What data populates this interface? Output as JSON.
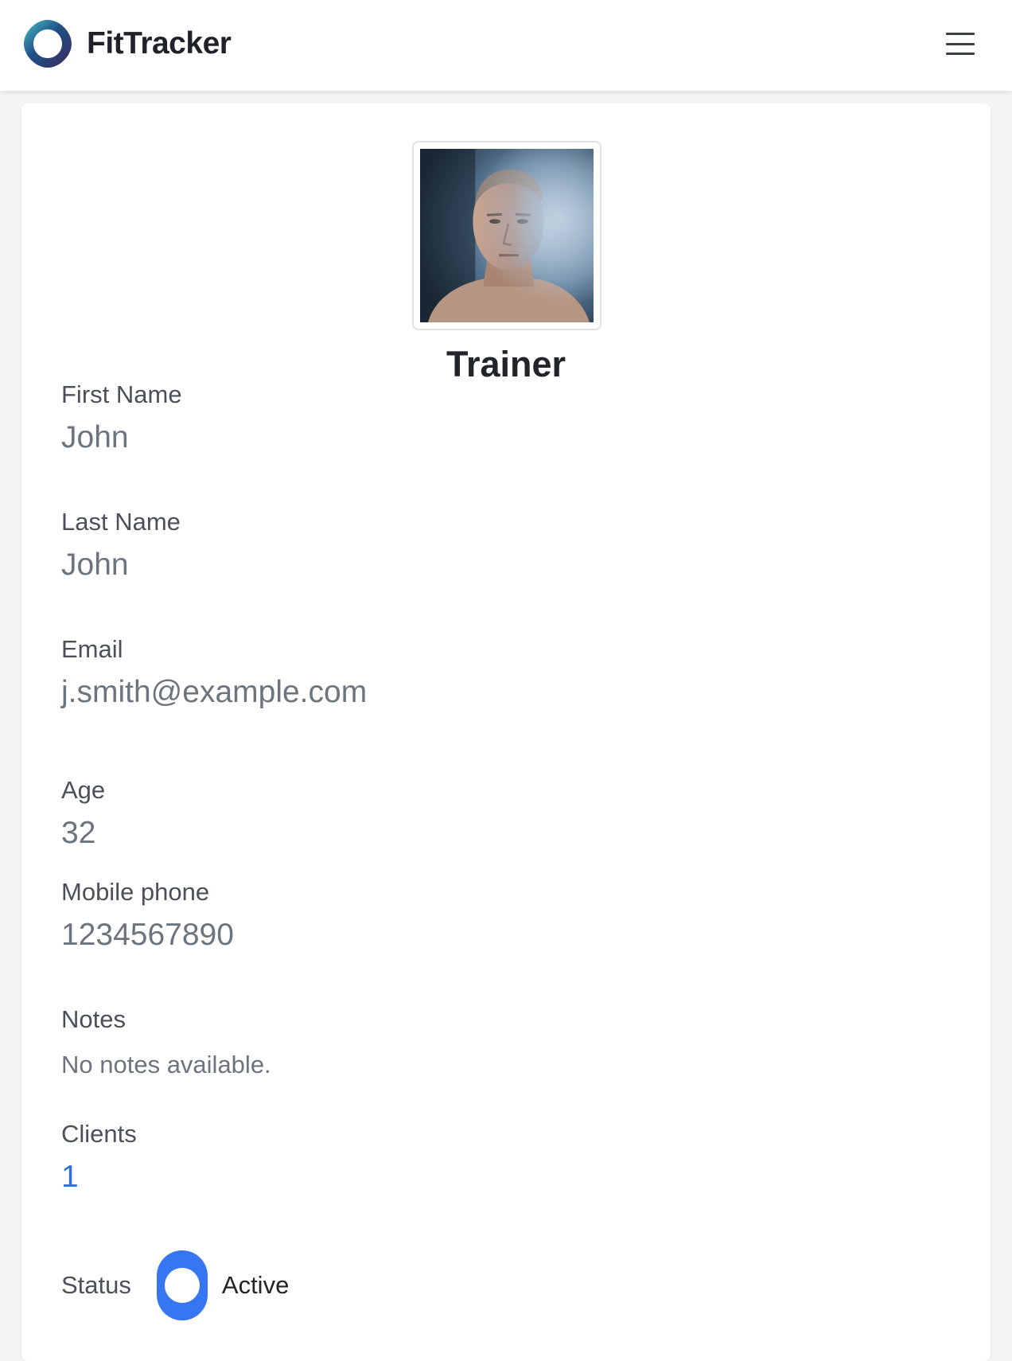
{
  "app": {
    "name": "FitTracker",
    "colors": {
      "accent": "#3676f2",
      "link": "#2f6fe4",
      "text_primary": "#212529",
      "text_muted": "#6c757d"
    }
  },
  "navbar": {
    "logo_icon": "ring-logo-icon",
    "menu_icon": "hamburger-menu-icon"
  },
  "profile": {
    "role": "Trainer",
    "fields": {
      "first_name": {
        "label": "First Name",
        "value": "John"
      },
      "last_name": {
        "label": "Last Name",
        "value": "John"
      },
      "email": {
        "label": "Email",
        "value": "j.smith@example.com"
      },
      "age": {
        "label": "Age",
        "value": "32"
      },
      "mobile": {
        "label": "Mobile phone",
        "value": "1234567890"
      },
      "notes": {
        "label": "Notes",
        "value": "No notes available."
      },
      "clients": {
        "label": "Clients",
        "value": "1"
      }
    },
    "status": {
      "label": "Status",
      "value": "Active",
      "enabled": true
    }
  }
}
